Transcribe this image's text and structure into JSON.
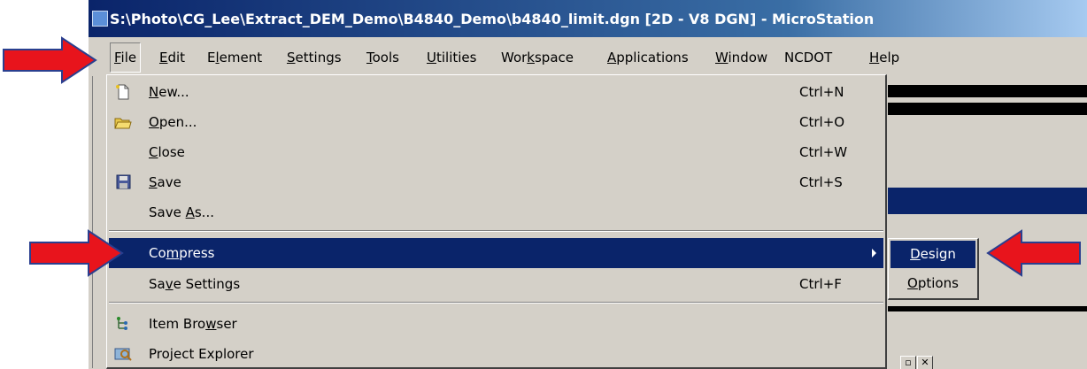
{
  "window": {
    "title": "S:\\Photo\\CG_Lee\\Extract_DEM_Demo\\B4840_Demo\\b4840_limit.dgn [2D - V8 DGN] - MicroStation"
  },
  "menubar": {
    "items": [
      {
        "pre": "",
        "ul": "F",
        "post": "ile"
      },
      {
        "pre": "",
        "ul": "E",
        "post": "dit"
      },
      {
        "pre": "E",
        "ul": "l",
        "post": "ement"
      },
      {
        "pre": "",
        "ul": "S",
        "post": "ettings"
      },
      {
        "pre": "",
        "ul": "T",
        "post": "ools"
      },
      {
        "pre": "",
        "ul": "U",
        "post": "tilities"
      },
      {
        "pre": "Wor",
        "ul": "k",
        "post": "space"
      },
      {
        "pre": "",
        "ul": "A",
        "post": "pplications"
      },
      {
        "pre": "",
        "ul": "W",
        "post": "indow"
      },
      {
        "pre": "NCDOT",
        "ul": "",
        "post": ""
      },
      {
        "pre": "",
        "ul": "H",
        "post": "elp"
      }
    ]
  },
  "file_menu": {
    "items": [
      {
        "pre": "",
        "ul": "N",
        "post": "ew...",
        "shortcut": "Ctrl+N",
        "icon": "new-file-icon"
      },
      {
        "pre": "",
        "ul": "O",
        "post": "pen...",
        "shortcut": "Ctrl+O",
        "icon": "open-folder-icon"
      },
      {
        "pre": "",
        "ul": "C",
        "post": "lose",
        "shortcut": "Ctrl+W",
        "icon": ""
      },
      {
        "pre": "",
        "ul": "S",
        "post": "ave",
        "shortcut": "Ctrl+S",
        "icon": "save-disk-icon"
      },
      {
        "pre": "Save ",
        "ul": "A",
        "post": "s...",
        "shortcut": "",
        "icon": ""
      },
      {
        "pre": "Co",
        "ul": "m",
        "post": "press",
        "shortcut": "",
        "icon": ""
      },
      {
        "pre": "Sa",
        "ul": "v",
        "post": "e Settings",
        "shortcut": "Ctrl+F",
        "icon": ""
      },
      {
        "pre": "Item Bro",
        "ul": "w",
        "post": "ser",
        "shortcut": "",
        "icon": "item-browser-icon"
      },
      {
        "pre": "Project Explorer",
        "ul": "",
        "post": "",
        "shortcut": "",
        "icon": "project-explorer-icon"
      }
    ]
  },
  "compress_submenu": {
    "items": [
      {
        "pre": "",
        "ul": "D",
        "post": "esign"
      },
      {
        "pre": "",
        "ul": "O",
        "post": "ptions"
      }
    ]
  },
  "colors": {
    "menu_bg": "#d4d0c8",
    "highlight": "#0a246a",
    "arrow_red": "#e8141c",
    "arrow_outline": "#2a3f8f"
  }
}
